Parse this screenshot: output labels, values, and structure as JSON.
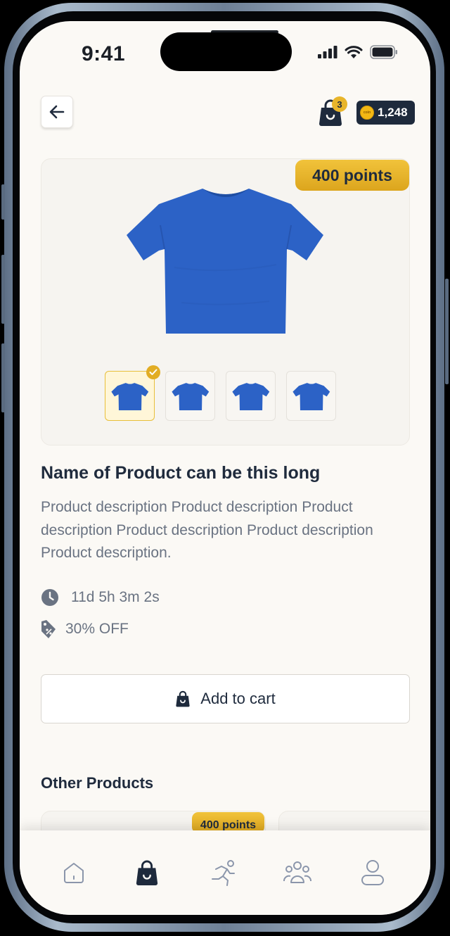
{
  "status_bar": {
    "time": "9:41",
    "icons": [
      "signal-icon",
      "wifi-icon",
      "battery-icon"
    ]
  },
  "header": {
    "back_icon": "arrow-left-icon",
    "cart_icon": "shopping-bag-icon",
    "cart_count": "3",
    "coin_label": "coin",
    "points_balance": "1,248"
  },
  "product": {
    "price": "400 points",
    "image_color": "#2c62c6",
    "selected_thumbnail": 0,
    "thumbnail_count": 4,
    "name": "Name of Product can be this long",
    "description": "Product description Product description Product description Product description Product description Product description.",
    "countdown": "11d 5h 3m 2s",
    "discount": "30% OFF"
  },
  "actions": {
    "add_to_cart": "Add to cart"
  },
  "other_products": {
    "title": "Other Products",
    "items": [
      {
        "price": "400 points"
      }
    ]
  },
  "tabbar": {
    "tabs": [
      {
        "name": "home-icon",
        "active": false
      },
      {
        "name": "shopping-bag-icon",
        "active": true
      },
      {
        "name": "running-icon",
        "active": false
      },
      {
        "name": "community-icon",
        "active": false
      },
      {
        "name": "profile-icon",
        "active": false
      }
    ]
  },
  "colors": {
    "accent_gold": "#e8b52a",
    "navy": "#1e2a3c",
    "background": "#fbf9f5",
    "muted_text": "#6a7382"
  }
}
